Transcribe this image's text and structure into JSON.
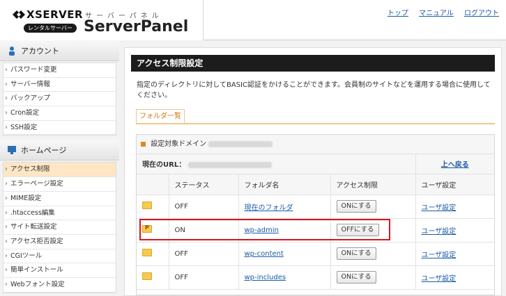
{
  "header": {
    "brand": "XSERVER",
    "brand_badge": "レンタルサーバー",
    "panel_kana": "サーバーパネル",
    "panel_title": "ServerPanel",
    "links": [
      "トップ",
      "マニュアル",
      "ログアウト"
    ]
  },
  "sidebar": {
    "sections": [
      {
        "title": "アカウント",
        "icon": "person-icon",
        "items": [
          "パスワード変更",
          "サーバー情報",
          "バックアップ",
          "Cron設定",
          "SSH設定"
        ]
      },
      {
        "title": "ホームページ",
        "icon": "monitor-icon",
        "items": [
          "アクセス制限",
          "エラーページ設定",
          "MIME設定",
          ".htaccess編集",
          "サイト転送設定",
          "アクセス拒否設定",
          "CGIツール",
          "簡単インストール",
          "Webフォント設定"
        ],
        "active": "アクセス制限"
      }
    ]
  },
  "main": {
    "page_title": "アクセス制限設定",
    "description": "指定のディレクトリに対してBASIC認証をかけることができます。会員制のサイトなどを運用する場合に使用してください。",
    "folder_tab": "フォルダ一覧",
    "domain_label": "設定対象ドメイン",
    "url_label": "現在のURL：",
    "back_link": "上へ戻る",
    "columns": [
      "ステータス",
      "フォルダ名",
      "アクセス制限",
      "ユーザ設定"
    ],
    "rows": [
      {
        "status": "OFF",
        "folder": "現在のフォルダ",
        "action": "ONにする",
        "user": "ユーザ設定",
        "protected": false
      },
      {
        "status": "ON",
        "folder": "wp-admin",
        "action": "OFFにする",
        "user": "ユーザ設定",
        "protected": true
      },
      {
        "status": "OFF",
        "folder": "wp-content",
        "action": "ONにする",
        "user": "ユーザ設定",
        "protected": false
      },
      {
        "status": "OFF",
        "folder": "wp-includes",
        "action": "ONにする",
        "user": "ユーザ設定",
        "protected": false
      }
    ]
  },
  "colors": {
    "accent": "#d07a1a",
    "highlight": "#d9141b",
    "link": "#1b5aa8"
  }
}
